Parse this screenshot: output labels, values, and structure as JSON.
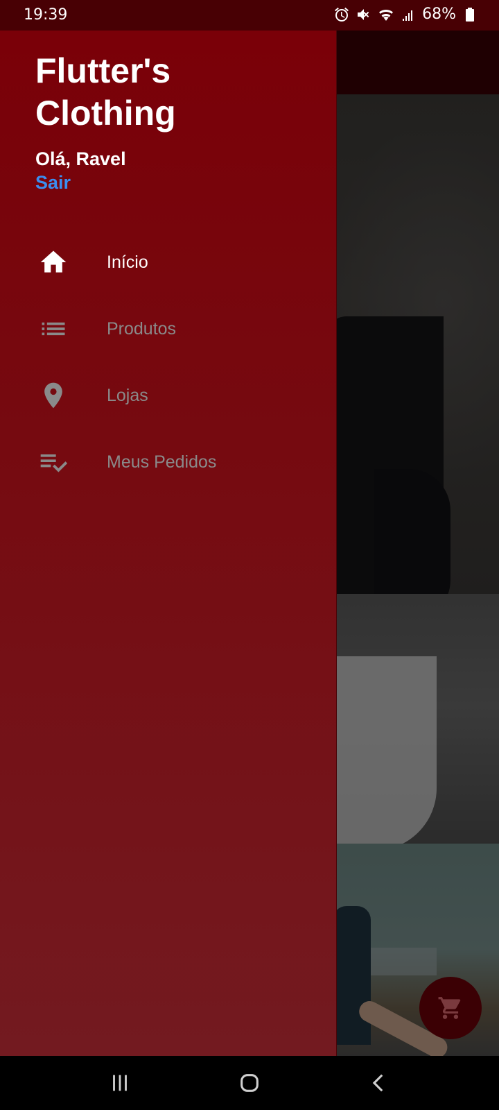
{
  "status_bar": {
    "time": "19:39",
    "battery": "68%",
    "icons": [
      "alarm-icon",
      "mute-icon",
      "wifi-icon",
      "signal-icon",
      "battery-icon"
    ]
  },
  "drawer": {
    "title": "Flutter's Clothing",
    "greeting": "Olá, Ravel",
    "logout_label": "Sair",
    "items": [
      {
        "label": "Início",
        "icon": "home-icon",
        "active": true
      },
      {
        "label": "Produtos",
        "icon": "list-icon",
        "active": false
      },
      {
        "label": "Lojas",
        "icon": "location-pin-icon",
        "active": false
      },
      {
        "label": "Meus Pedidos",
        "icon": "playlist-check-icon",
        "active": false
      }
    ]
  },
  "fab": {
    "icon": "cart-icon"
  },
  "nav_bar": {
    "icons": [
      "recent-apps-icon",
      "home-button-icon",
      "back-icon"
    ]
  },
  "colors": {
    "drawer_top": "#7a0008",
    "drawer_bottom": "#731a20",
    "accent_link": "#3b8ef0",
    "inactive_text": "#8a8a8a"
  }
}
